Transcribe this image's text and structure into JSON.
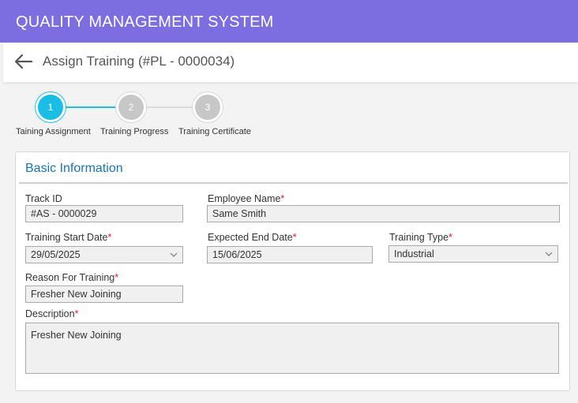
{
  "app": {
    "title": "QUALITY MANAGEMENT SYSTEM"
  },
  "header": {
    "page_title": "Assign Training (#PL - 0000034)"
  },
  "stepper": {
    "steps": [
      {
        "number": "1",
        "label": "Taining Assignment",
        "state": "active"
      },
      {
        "number": "2",
        "label": "Training Progress",
        "state": "inactive"
      },
      {
        "number": "3",
        "label": "Training Certificate",
        "state": "inactive"
      }
    ]
  },
  "form": {
    "section_title": "Basic Information",
    "required_mark": "*",
    "track_id": {
      "label": "Track ID",
      "value": "#AS - 0000029"
    },
    "employee_name": {
      "label": "Employee Name",
      "value": "Same Smith"
    },
    "training_start_date": {
      "label": "Training Start Date",
      "value": "29/05/2025"
    },
    "expected_end_date": {
      "label": "Expected End Date",
      "value": "15/06/2025"
    },
    "training_type": {
      "label": "Training Type",
      "value": "Industrial"
    },
    "reason_for_training": {
      "label": "Reason For Training",
      "value": "Fresher New Joining"
    },
    "description": {
      "label": "Description",
      "value": "Fresher New Joining"
    }
  },
  "colors": {
    "topbar": "#7c6ee0",
    "accent": "#19bde6",
    "section_title": "#1a73b8",
    "required": "#e0182d"
  },
  "icons": {
    "back": "arrow-left-icon",
    "dropdown": "chevron-down-icon"
  }
}
